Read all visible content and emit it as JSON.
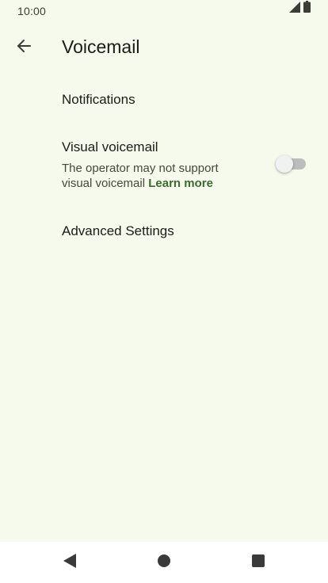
{
  "status_bar": {
    "time": "10:00",
    "icons": [
      "signal-icon",
      "battery-icon"
    ]
  },
  "app_bar": {
    "back_icon": "arrow-back-icon",
    "title": "Voicemail"
  },
  "settings": {
    "notifications": {
      "title": "Notifications"
    },
    "visual_voicemail": {
      "title": "Visual voicemail",
      "summary": "The operator may not support visual voicemail",
      "link": "Learn more",
      "enabled": false
    },
    "advanced": {
      "title": "Advanced Settings"
    }
  },
  "nav_bar": {
    "icons": [
      "nav-back-icon",
      "nav-home-icon",
      "nav-recents-icon"
    ]
  },
  "colors": {
    "background": "#f5faec",
    "link": "#3c6a2f",
    "text_primary": "#1b1c18",
    "text_secondary": "#45483f",
    "nav_bar": "#ffffff"
  }
}
